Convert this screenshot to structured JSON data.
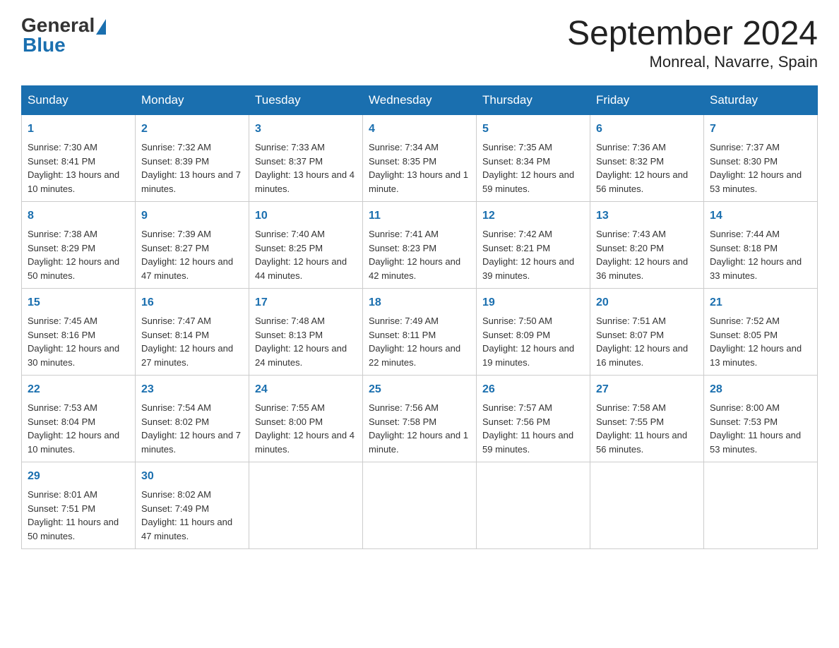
{
  "logo": {
    "text_general": "General",
    "text_blue": "Blue"
  },
  "title": "September 2024",
  "subtitle": "Monreal, Navarre, Spain",
  "days": [
    "Sunday",
    "Monday",
    "Tuesday",
    "Wednesday",
    "Thursday",
    "Friday",
    "Saturday"
  ],
  "weeks": [
    [
      {
        "day": "1",
        "sunrise": "7:30 AM",
        "sunset": "8:41 PM",
        "daylight": "13 hours and 10 minutes."
      },
      {
        "day": "2",
        "sunrise": "7:32 AM",
        "sunset": "8:39 PM",
        "daylight": "13 hours and 7 minutes."
      },
      {
        "day": "3",
        "sunrise": "7:33 AM",
        "sunset": "8:37 PM",
        "daylight": "13 hours and 4 minutes."
      },
      {
        "day": "4",
        "sunrise": "7:34 AM",
        "sunset": "8:35 PM",
        "daylight": "13 hours and 1 minute."
      },
      {
        "day": "5",
        "sunrise": "7:35 AM",
        "sunset": "8:34 PM",
        "daylight": "12 hours and 59 minutes."
      },
      {
        "day": "6",
        "sunrise": "7:36 AM",
        "sunset": "8:32 PM",
        "daylight": "12 hours and 56 minutes."
      },
      {
        "day": "7",
        "sunrise": "7:37 AM",
        "sunset": "8:30 PM",
        "daylight": "12 hours and 53 minutes."
      }
    ],
    [
      {
        "day": "8",
        "sunrise": "7:38 AM",
        "sunset": "8:29 PM",
        "daylight": "12 hours and 50 minutes."
      },
      {
        "day": "9",
        "sunrise": "7:39 AM",
        "sunset": "8:27 PM",
        "daylight": "12 hours and 47 minutes."
      },
      {
        "day": "10",
        "sunrise": "7:40 AM",
        "sunset": "8:25 PM",
        "daylight": "12 hours and 44 minutes."
      },
      {
        "day": "11",
        "sunrise": "7:41 AM",
        "sunset": "8:23 PM",
        "daylight": "12 hours and 42 minutes."
      },
      {
        "day": "12",
        "sunrise": "7:42 AM",
        "sunset": "8:21 PM",
        "daylight": "12 hours and 39 minutes."
      },
      {
        "day": "13",
        "sunrise": "7:43 AM",
        "sunset": "8:20 PM",
        "daylight": "12 hours and 36 minutes."
      },
      {
        "day": "14",
        "sunrise": "7:44 AM",
        "sunset": "8:18 PM",
        "daylight": "12 hours and 33 minutes."
      }
    ],
    [
      {
        "day": "15",
        "sunrise": "7:45 AM",
        "sunset": "8:16 PM",
        "daylight": "12 hours and 30 minutes."
      },
      {
        "day": "16",
        "sunrise": "7:47 AM",
        "sunset": "8:14 PM",
        "daylight": "12 hours and 27 minutes."
      },
      {
        "day": "17",
        "sunrise": "7:48 AM",
        "sunset": "8:13 PM",
        "daylight": "12 hours and 24 minutes."
      },
      {
        "day": "18",
        "sunrise": "7:49 AM",
        "sunset": "8:11 PM",
        "daylight": "12 hours and 22 minutes."
      },
      {
        "day": "19",
        "sunrise": "7:50 AM",
        "sunset": "8:09 PM",
        "daylight": "12 hours and 19 minutes."
      },
      {
        "day": "20",
        "sunrise": "7:51 AM",
        "sunset": "8:07 PM",
        "daylight": "12 hours and 16 minutes."
      },
      {
        "day": "21",
        "sunrise": "7:52 AM",
        "sunset": "8:05 PM",
        "daylight": "12 hours and 13 minutes."
      }
    ],
    [
      {
        "day": "22",
        "sunrise": "7:53 AM",
        "sunset": "8:04 PM",
        "daylight": "12 hours and 10 minutes."
      },
      {
        "day": "23",
        "sunrise": "7:54 AM",
        "sunset": "8:02 PM",
        "daylight": "12 hours and 7 minutes."
      },
      {
        "day": "24",
        "sunrise": "7:55 AM",
        "sunset": "8:00 PM",
        "daylight": "12 hours and 4 minutes."
      },
      {
        "day": "25",
        "sunrise": "7:56 AM",
        "sunset": "7:58 PM",
        "daylight": "12 hours and 1 minute."
      },
      {
        "day": "26",
        "sunrise": "7:57 AM",
        "sunset": "7:56 PM",
        "daylight": "11 hours and 59 minutes."
      },
      {
        "day": "27",
        "sunrise": "7:58 AM",
        "sunset": "7:55 PM",
        "daylight": "11 hours and 56 minutes."
      },
      {
        "day": "28",
        "sunrise": "8:00 AM",
        "sunset": "7:53 PM",
        "daylight": "11 hours and 53 minutes."
      }
    ],
    [
      {
        "day": "29",
        "sunrise": "8:01 AM",
        "sunset": "7:51 PM",
        "daylight": "11 hours and 50 minutes."
      },
      {
        "day": "30",
        "sunrise": "8:02 AM",
        "sunset": "7:49 PM",
        "daylight": "11 hours and 47 minutes."
      },
      null,
      null,
      null,
      null,
      null
    ]
  ],
  "labels": {
    "sunrise": "Sunrise:",
    "sunset": "Sunset:",
    "daylight": "Daylight:"
  }
}
